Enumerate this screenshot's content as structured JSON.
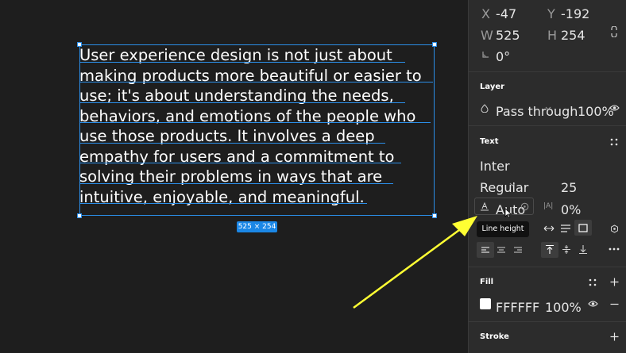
{
  "canvas": {
    "text_lines": [
      "User experience design is not just about",
      "making products more beautiful or easier to",
      "use; it's about understanding the needs,",
      "behaviors, and emotions of the people who",
      "use those products. It involves a deep",
      "empathy for users and a commitment to",
      "solving their problems in ways that are",
      "intuitive, enjoyable, and meaningful."
    ],
    "size_badge": "525 × 254",
    "selection_color": "#2b8ee8"
  },
  "panel": {
    "x_label": "X",
    "x_value": "-47",
    "y_label": "Y",
    "y_value": "-192",
    "w_label": "W",
    "w_value": "525",
    "h_label": "H",
    "h_value": "254",
    "rotation_value": "0°",
    "layer": {
      "title": "Layer",
      "blend_mode": "Pass through",
      "opacity": "100%"
    },
    "text": {
      "title": "Text",
      "font_family": "Inter",
      "font_weight": "Regular",
      "font_size": "25",
      "line_height": "Auto",
      "letter_spacing": "0%",
      "tooltip": "Line height"
    },
    "fill": {
      "title": "Fill",
      "hex": "FFFFFF",
      "opacity": "100%",
      "swatch_color": "#ffffff"
    },
    "stroke": {
      "title": "Stroke"
    }
  },
  "annotation": {
    "arrow_color": "#ffff33"
  }
}
